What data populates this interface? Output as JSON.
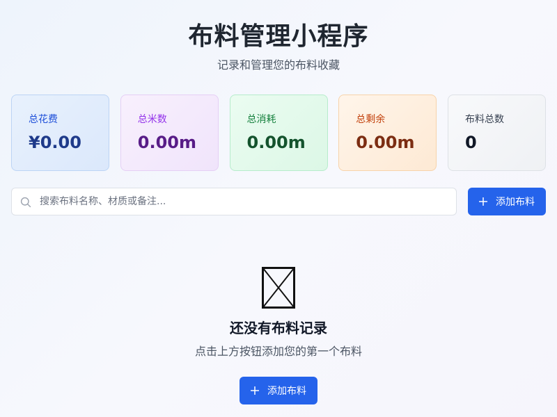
{
  "header": {
    "title": "布料管理小程序",
    "subtitle": "记录和管理您的布料收藏"
  },
  "stats": [
    {
      "label": "总花费",
      "value": "¥0.00"
    },
    {
      "label": "总米数",
      "value": "0.00m"
    },
    {
      "label": "总消耗",
      "value": "0.00m"
    },
    {
      "label": "总剩余",
      "value": "0.00m"
    },
    {
      "label": "布料总数",
      "value": "0"
    }
  ],
  "search": {
    "placeholder": "搜索布料名称、材质或备注...",
    "value": "",
    "icon": "search-icon"
  },
  "toolbar": {
    "add_label": "添加布料",
    "add_icon": "plus-icon"
  },
  "empty_state": {
    "icon": "image-placeholder-icon",
    "title": "还没有布料记录",
    "description": "点击上方按钮添加您的第一个布料",
    "button_label": "添加布料"
  },
  "colors": {
    "primary": "#2563eb",
    "title": "#1f2630",
    "card_blue": "#1e3a8a",
    "card_purple": "#581c87",
    "card_green": "#14532d",
    "card_orange": "#7c2d12"
  }
}
